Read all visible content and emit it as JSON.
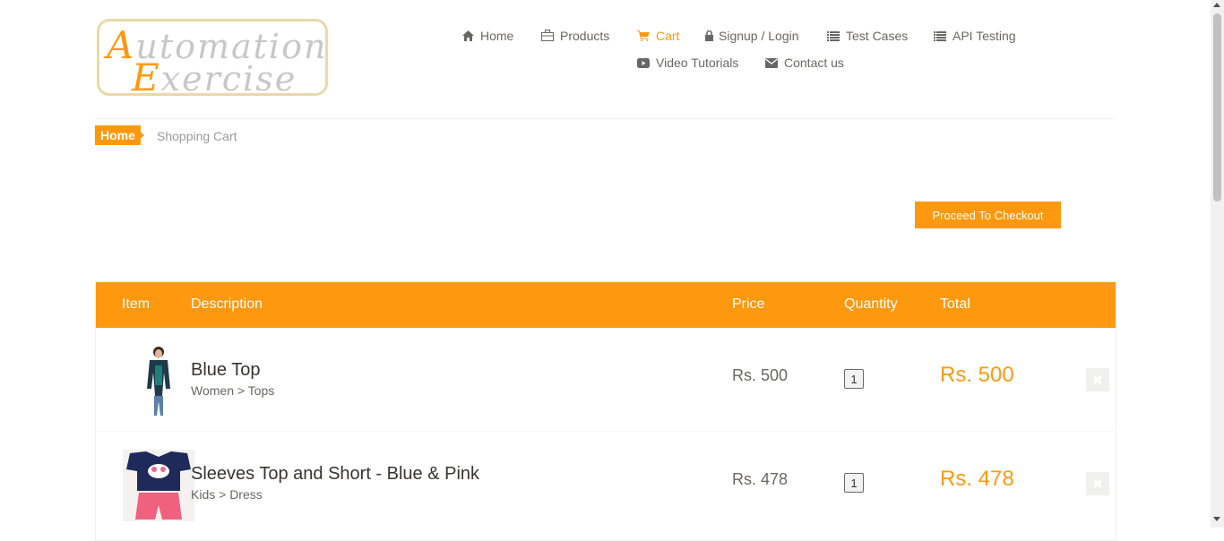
{
  "logo": {
    "line1_cap": "A",
    "line1_rest": "utomation",
    "line2_cap": "E",
    "line2_rest": "xercise"
  },
  "nav": {
    "home": {
      "icon": "home-icon",
      "label": "Home"
    },
    "products": {
      "icon": "briefcase-icon",
      "label": "Products"
    },
    "cart": {
      "icon": "shopping-cart-icon",
      "label": "Cart"
    },
    "login": {
      "icon": "lock-icon",
      "label": "Signup / Login"
    },
    "test_cases": {
      "icon": "list-icon",
      "label": "Test Cases"
    },
    "api_testing": {
      "icon": "list-icon",
      "label": "API Testing"
    },
    "video_tutorials": {
      "icon": "youtube-play-icon",
      "label": "Video Tutorials"
    },
    "contact": {
      "icon": "envelope-icon",
      "label": "Contact us"
    }
  },
  "breadcrumb": {
    "home": "Home",
    "current": "Shopping Cart"
  },
  "checkout": {
    "label": "Proceed To Checkout"
  },
  "table": {
    "headers": {
      "item": "Item",
      "description": "Description",
      "price": "Price",
      "quantity": "Quantity",
      "total": "Total"
    },
    "rows": [
      {
        "name": "Blue Top",
        "category": "Women > Tops",
        "price": "Rs. 500",
        "quantity": "1",
        "total": "Rs. 500",
        "delete_icon": "times-icon"
      },
      {
        "name": "Sleeves Top and Short - Blue & Pink",
        "category": "Kids > Dress",
        "price": "Rs. 478",
        "quantity": "1",
        "total": "Rs. 478",
        "delete_icon": "times-icon"
      }
    ]
  },
  "colors": {
    "accent": "#fe980f",
    "text": "#696763",
    "heading": "#363432"
  }
}
